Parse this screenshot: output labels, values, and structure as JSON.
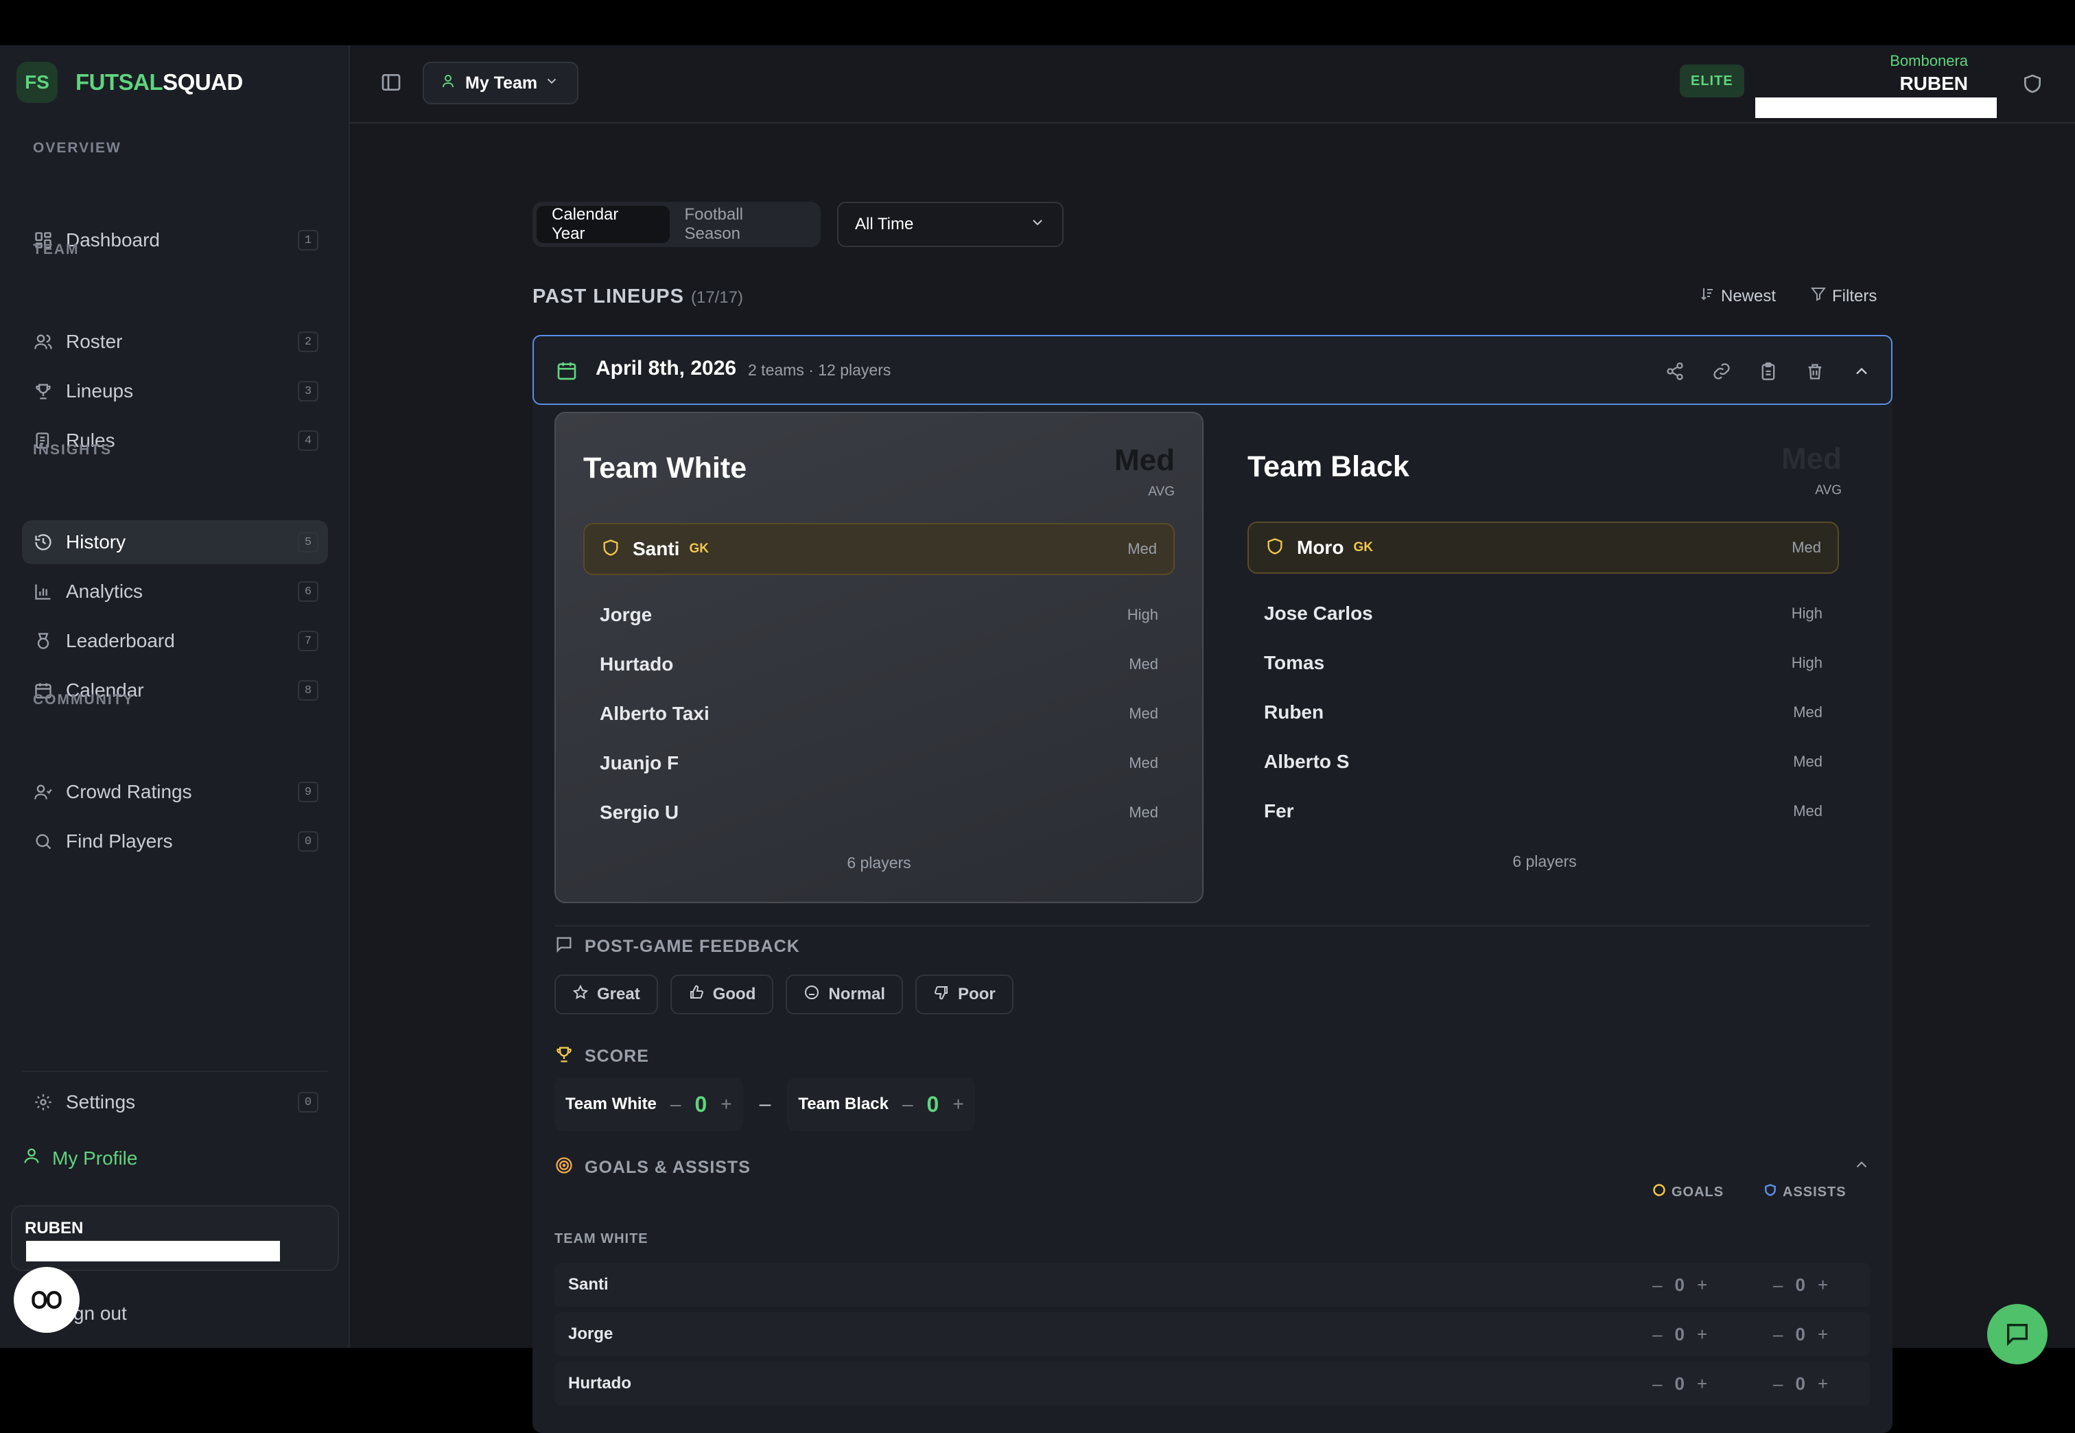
{
  "brand": {
    "badge": "FS",
    "name_part1": "FUTSAL",
    "name_part2": "SQUAD"
  },
  "sidebar": {
    "sections": {
      "overview": "OVERVIEW",
      "team": "TEAM",
      "insights": "INSIGHTS",
      "community": "COMMUNITY"
    },
    "items": [
      {
        "label": "Dashboard",
        "num": "1",
        "icon": "dashboard-icon"
      },
      {
        "label": "Roster",
        "num": "2",
        "icon": "users-icon"
      },
      {
        "label": "Lineups",
        "num": "3",
        "icon": "trophy-icon"
      },
      {
        "label": "Rules",
        "num": "4",
        "icon": "rules-icon"
      },
      {
        "label": "History",
        "num": "5",
        "icon": "history-icon",
        "active": true
      },
      {
        "label": "Analytics",
        "num": "6",
        "icon": "bar-chart-icon"
      },
      {
        "label": "Leaderboard",
        "num": "7",
        "icon": "medal-icon"
      },
      {
        "label": "Calendar",
        "num": "8",
        "icon": "calendar-icon"
      },
      {
        "label": "Crowd Ratings",
        "num": "9",
        "icon": "crowd-icon"
      },
      {
        "label": "Find Players",
        "num": "0",
        "icon": "search-icon"
      }
    ],
    "settings": {
      "label": "Settings",
      "num": "0"
    },
    "my_profile": "My Profile",
    "user_name": "RUBEN",
    "sign_out": "Sign out"
  },
  "header": {
    "team_select": "My Team",
    "tier": "ELITE",
    "venue": "Bombonera",
    "user": "RUBEN"
  },
  "filters": {
    "segments": [
      "Calendar Year",
      "Football Season"
    ],
    "active_segment": "Calendar Year",
    "period": "All Time"
  },
  "past_lineups": {
    "title": "PAST LINEUPS",
    "count": "(17/17)",
    "sort": "Newest",
    "filters": "Filters"
  },
  "match": {
    "date": "April 8th, 2026",
    "meta": "2 teams · 12 players",
    "teams": [
      {
        "name": "Team White",
        "level": "Med",
        "avg_label": "AVG",
        "gk": {
          "name": "Santi",
          "tag": "GK",
          "level": "Med"
        },
        "players": [
          {
            "name": "Jorge",
            "level": "High"
          },
          {
            "name": "Hurtado",
            "level": "Med"
          },
          {
            "name": "Alberto Taxi",
            "level": "Med"
          },
          {
            "name": "Juanjo F",
            "level": "Med"
          },
          {
            "name": "Sergio U",
            "level": "Med"
          }
        ],
        "count": "6 players"
      },
      {
        "name": "Team Black",
        "level": "Med",
        "avg_label": "AVG",
        "gk": {
          "name": "Moro",
          "tag": "GK",
          "level": "Med"
        },
        "players": [
          {
            "name": "Jose Carlos",
            "level": "High"
          },
          {
            "name": "Tomas",
            "level": "High"
          },
          {
            "name": "Ruben",
            "level": "Med"
          },
          {
            "name": "Alberto S",
            "level": "Med"
          },
          {
            "name": "Fer",
            "level": "Med"
          }
        ],
        "count": "6 players"
      }
    ],
    "feedback": {
      "title": "POST-GAME FEEDBACK",
      "options": [
        "Great",
        "Good",
        "Normal",
        "Poor"
      ]
    },
    "score": {
      "title": "SCORE",
      "team1": "Team White",
      "value1": "0",
      "team2": "Team Black",
      "value2": "0",
      "dash": "–"
    },
    "goals_assists": {
      "title": "GOALS & ASSISTS",
      "goals_label": "GOALS",
      "assists_label": "ASSISTS",
      "team_label": "TEAM WHITE",
      "rows": [
        {
          "name": "Santi",
          "goals": "0",
          "assists": "0"
        },
        {
          "name": "Jorge",
          "goals": "0",
          "assists": "0"
        },
        {
          "name": "Hurtado",
          "goals": "0",
          "assists": "0"
        }
      ]
    }
  },
  "colors": {
    "accent": "#5fd47e",
    "gk": "#f2c84b",
    "focus": "#5a8fe6"
  }
}
